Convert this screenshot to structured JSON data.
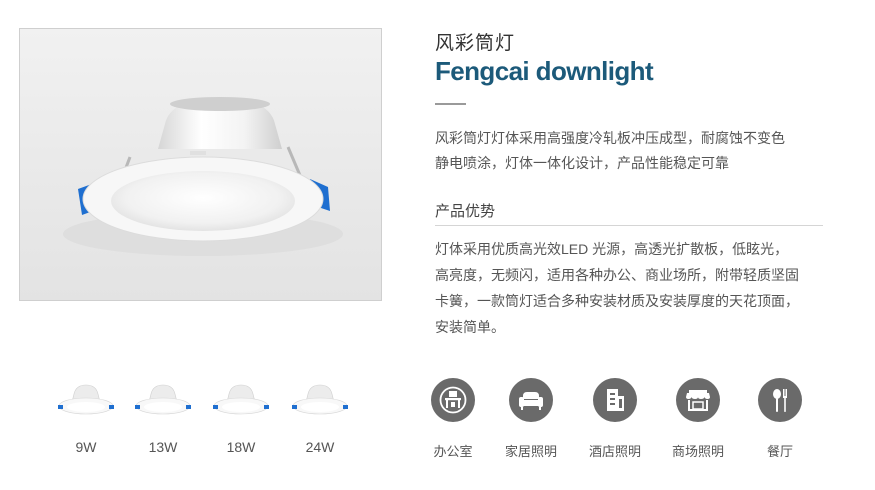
{
  "product": {
    "title_cn": "风彩筒灯",
    "title_en": "Fengcai downlight",
    "description_lines": [
      "风彩筒灯灯体采用高强度冷轧板冲压成型，耐腐蚀不变色",
      "静电喷涂，灯体一体化设计，产品性能稳定可靠"
    ]
  },
  "advantages": {
    "heading": "产品优势",
    "lines": [
      "灯体采用优质高光效LED 光源，高透光扩散板，低眩光，",
      "高亮度，无频闪，适用各种办公、商业场所，附带轻质坚固",
      "卡簧，一款筒灯适合多种安装材质及安装厚度的天花顶面，",
      "安装简单。"
    ]
  },
  "variants": [
    {
      "label": "9W"
    },
    {
      "label": "13W"
    },
    {
      "label": "18W"
    },
    {
      "label": "24W"
    }
  ],
  "applications": [
    {
      "label": "办公室",
      "icon": "office-desk-icon"
    },
    {
      "label": "家居照明",
      "icon": "sofa-icon"
    },
    {
      "label": "酒店照明",
      "icon": "hotel-building-icon"
    },
    {
      "label": "商场照明",
      "icon": "storefront-icon"
    },
    {
      "label": "餐厅",
      "icon": "dining-spoon-icon"
    }
  ],
  "colors": {
    "title_en": "#1c5a7a",
    "icon_bg": "#6a6a6a",
    "clip_blue": "#1f6fd0"
  }
}
